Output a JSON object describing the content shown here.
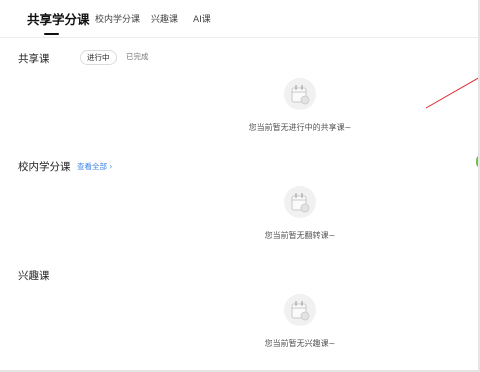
{
  "tabs": [
    {
      "label": "共享学分课"
    },
    {
      "label": "校内学分课"
    },
    {
      "label": "兴趣课"
    },
    {
      "label": "AI课"
    }
  ],
  "shared": {
    "title": "共享课",
    "filters": [
      "进行中",
      "已完成"
    ],
    "empty_text": "您当前暂无进行中的共享课~"
  },
  "campus": {
    "title": "校内学分课",
    "view_all": "查看全部",
    "view_all_arrow": "›",
    "empty_text": "您当前暂无翻转课~"
  },
  "interest": {
    "title": "兴趣课",
    "empty_text": "您当前暂无兴趣课~"
  },
  "colors": {
    "accent_link": "#3f86e6",
    "annotation_line": "#e0242a",
    "side_dot": "#6cc24a"
  },
  "icons": [
    "calendar-empty-icon",
    "chevron-right-icon"
  ]
}
